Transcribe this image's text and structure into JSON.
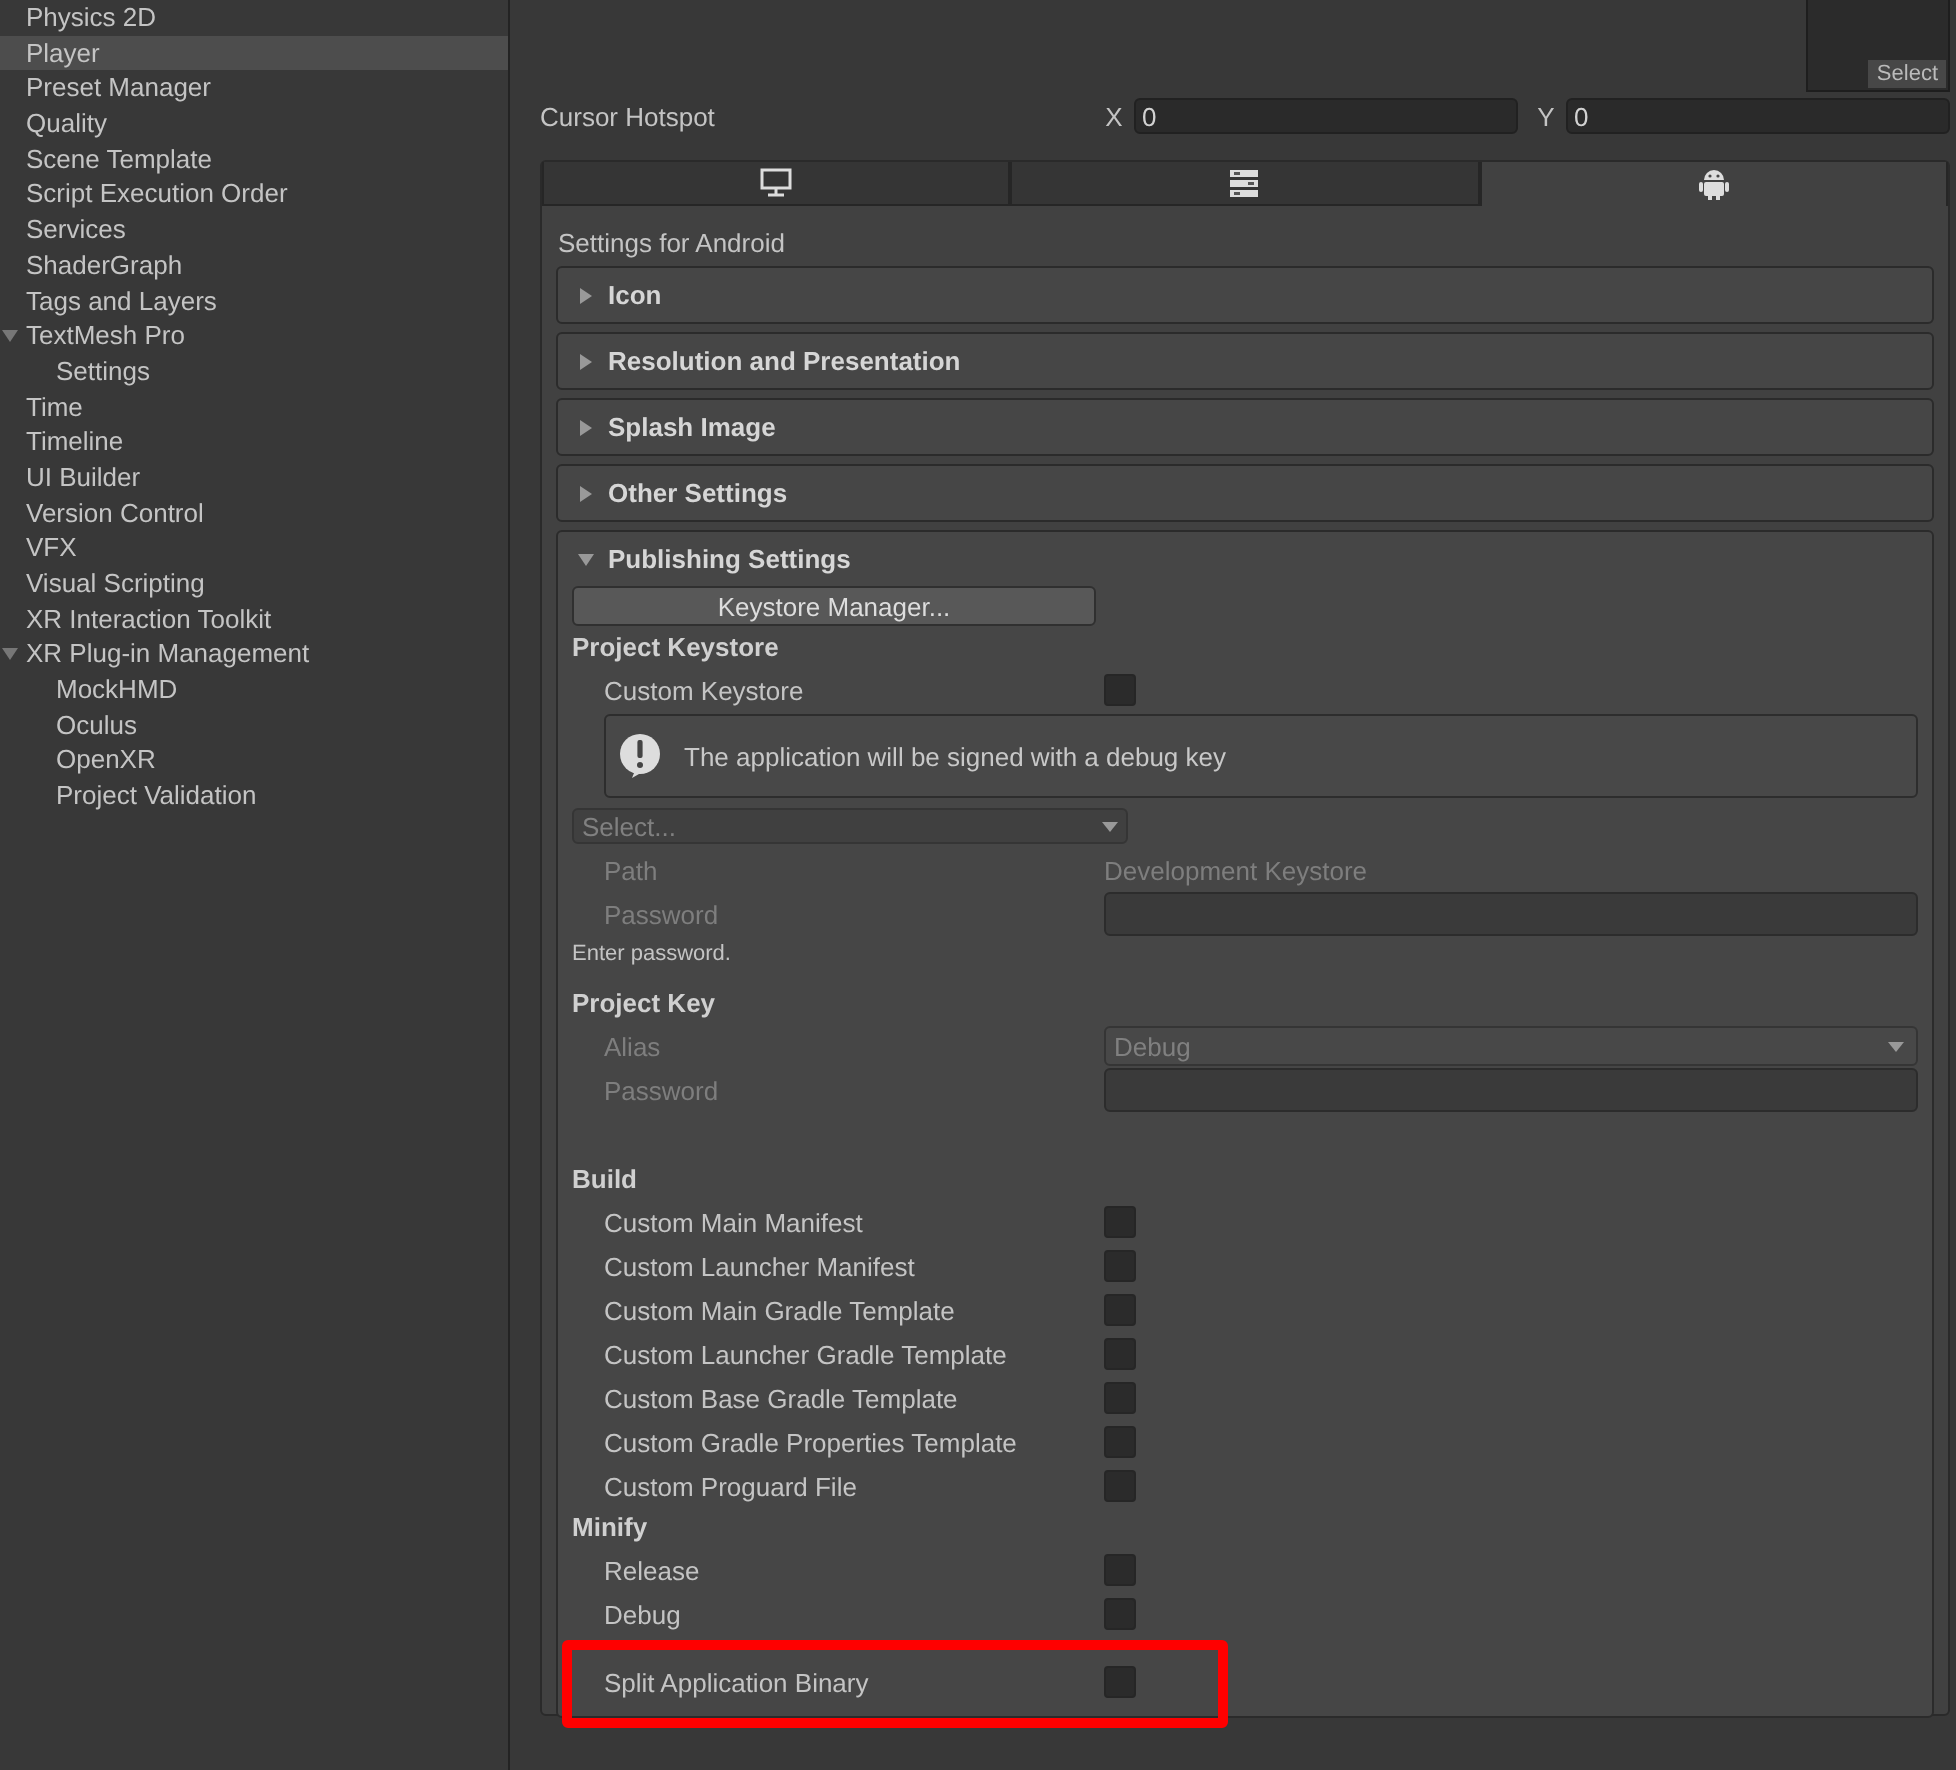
{
  "sidebar": {
    "items": [
      {
        "label": "Physics 2D",
        "selected": false
      },
      {
        "label": "Player",
        "selected": true
      },
      {
        "label": "Preset Manager",
        "selected": false
      },
      {
        "label": "Quality",
        "selected": false
      },
      {
        "label": "Scene Template",
        "selected": false
      },
      {
        "label": "Script Execution Order",
        "selected": false
      },
      {
        "label": "Services",
        "selected": false
      },
      {
        "label": "ShaderGraph",
        "selected": false
      },
      {
        "label": "Tags and Layers",
        "selected": false
      },
      {
        "label": "TextMesh Pro",
        "selected": false,
        "expanded": true,
        "children": [
          {
            "label": "Settings",
            "selected": false
          }
        ]
      },
      {
        "label": "Time",
        "selected": false
      },
      {
        "label": "Timeline",
        "selected": false
      },
      {
        "label": "UI Builder",
        "selected": false
      },
      {
        "label": "Version Control",
        "selected": false
      },
      {
        "label": "VFX",
        "selected": false
      },
      {
        "label": "Visual Scripting",
        "selected": false
      },
      {
        "label": "XR Interaction Toolkit",
        "selected": false
      },
      {
        "label": "XR Plug-in Management",
        "selected": false,
        "expanded": true,
        "children": [
          {
            "label": "MockHMD",
            "selected": false
          },
          {
            "label": "Oculus",
            "selected": false
          },
          {
            "label": "OpenXR",
            "selected": false
          },
          {
            "label": "Project Validation",
            "selected": false
          }
        ]
      }
    ]
  },
  "texture_preview": {
    "button": "Select"
  },
  "cursor_hotspot": {
    "label": "Cursor Hotspot",
    "x_label": "X",
    "x_value": "0",
    "y_label": "Y",
    "y_value": "0"
  },
  "platform_tabs": [
    {
      "kind": "desktop",
      "selected": false
    },
    {
      "kind": "server",
      "selected": false
    },
    {
      "kind": "android",
      "selected": true
    }
  ],
  "settings_title": "Settings for Android",
  "sections": [
    {
      "title": "Icon",
      "expanded": false
    },
    {
      "title": "Resolution and Presentation",
      "expanded": false
    },
    {
      "title": "Splash Image",
      "expanded": false
    },
    {
      "title": "Other Settings",
      "expanded": false
    },
    {
      "title": "Publishing Settings",
      "expanded": true,
      "rows": [
        {
          "kind": "button",
          "label": "Keystore Manager..."
        },
        {
          "kind": "header",
          "label": "Project Keystore"
        },
        {
          "kind": "toggle",
          "label": "Custom Keystore",
          "checked": false,
          "disabled": false
        },
        {
          "kind": "info",
          "label": "The application will be signed with a debug key"
        },
        {
          "kind": "select",
          "label": "Select...",
          "disabled": true
        },
        {
          "kind": "text",
          "label": "Path",
          "value": "Development Keystore",
          "disabled": true
        },
        {
          "kind": "password",
          "label": "Password",
          "disabled": true
        },
        {
          "kind": "hint",
          "label": "Enter password."
        },
        {
          "kind": "header",
          "label": "Project Key",
          "gap": true
        },
        {
          "kind": "dropdown",
          "label": "Alias",
          "value": "Debug",
          "disabled": true
        },
        {
          "kind": "password",
          "label": "Password",
          "disabled": true
        },
        {
          "kind": "header",
          "label": "Build",
          "gap": true
        },
        {
          "kind": "toggle",
          "label": "Custom Main Manifest",
          "checked": false,
          "disabled": false
        },
        {
          "kind": "toggle",
          "label": "Custom Launcher Manifest",
          "checked": false,
          "disabled": false
        },
        {
          "kind": "toggle",
          "label": "Custom Main Gradle Template",
          "checked": false,
          "disabled": false
        },
        {
          "kind": "toggle",
          "label": "Custom Launcher Gradle Template",
          "checked": false,
          "disabled": false
        },
        {
          "kind": "toggle",
          "label": "Custom Base Gradle Template",
          "checked": false,
          "disabled": false
        },
        {
          "kind": "toggle",
          "label": "Custom Gradle Properties Template",
          "checked": false,
          "disabled": false
        },
        {
          "kind": "toggle",
          "label": "Custom Proguard File",
          "checked": false,
          "disabled": false
        },
        {
          "kind": "header",
          "label": "Minify"
        },
        {
          "kind": "toggle",
          "label": "Release",
          "checked": false,
          "disabled": false
        },
        {
          "kind": "toggle",
          "label": "Debug",
          "checked": false,
          "disabled": false
        },
        {
          "kind": "toggle",
          "label": "Split Application Binary",
          "checked": false,
          "disabled": false,
          "highlighted": true
        }
      ]
    }
  ]
}
